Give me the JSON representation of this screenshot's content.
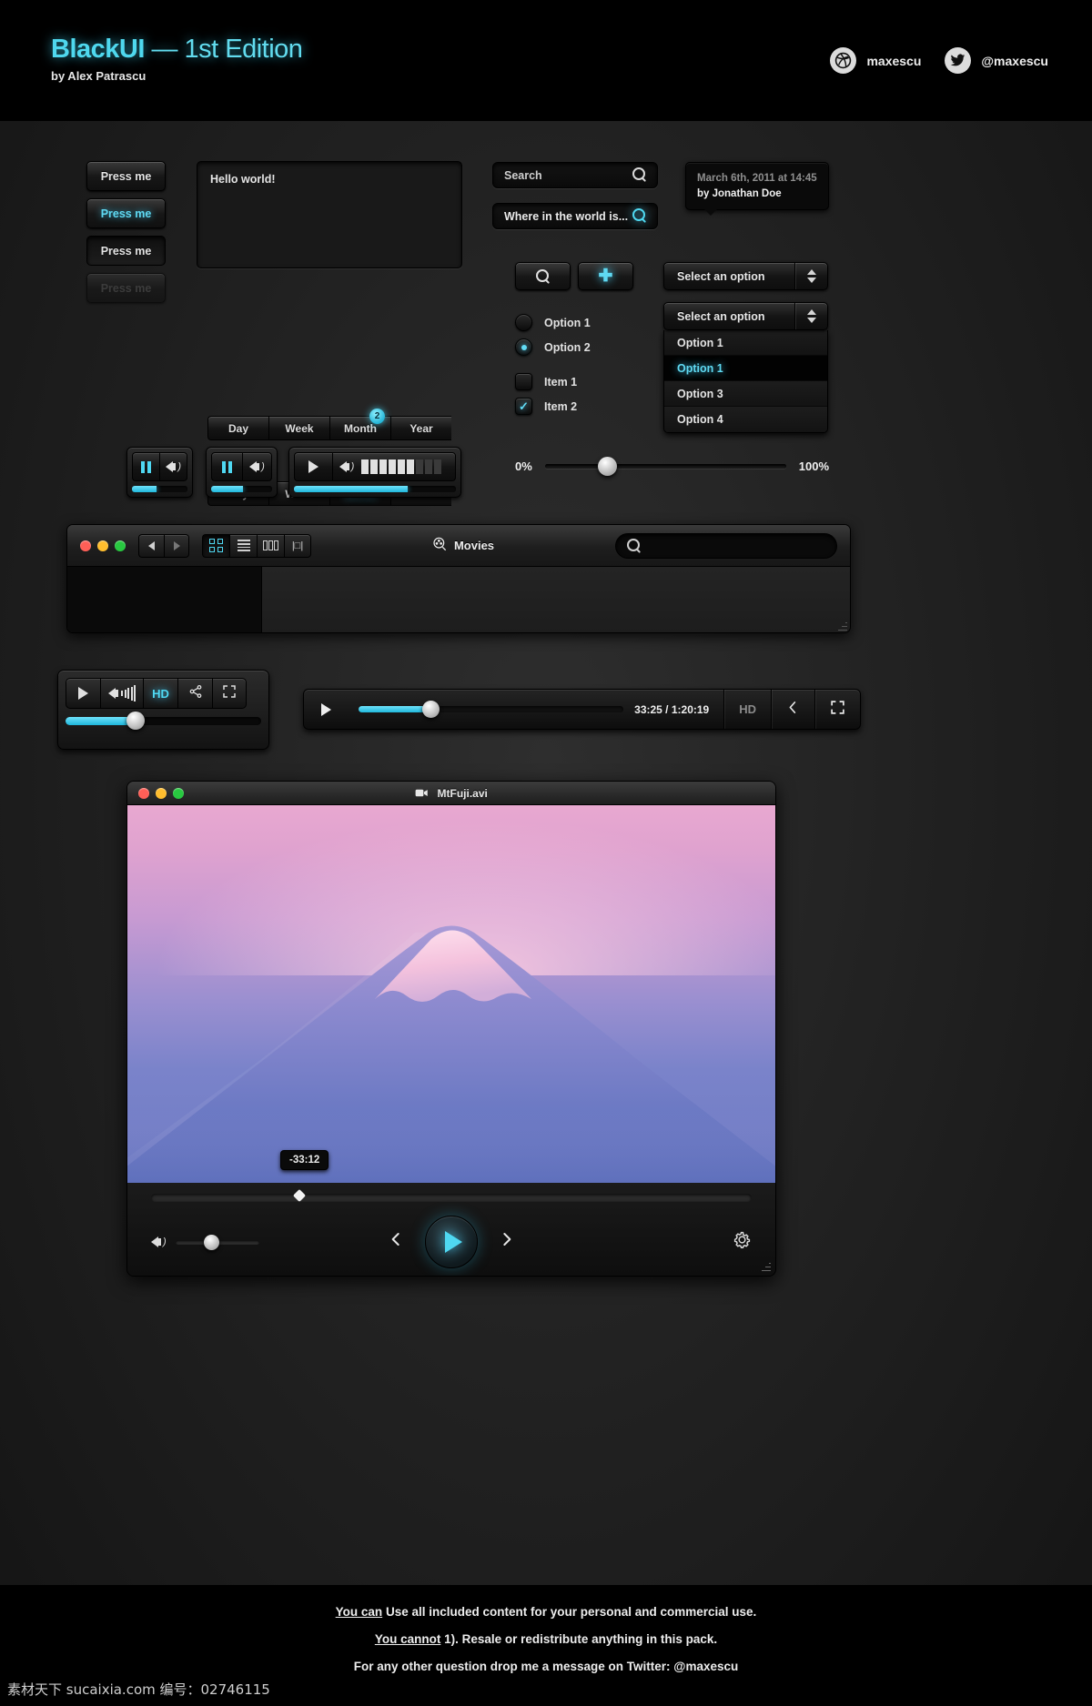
{
  "header": {
    "brand_bold": "BlackUI",
    "brand_rest": "— 1st Edition",
    "subtitle": "by Alex Patrascu",
    "socials": [
      {
        "icon": "dribbble-icon",
        "glyph": "◎",
        "label": "maxescu"
      },
      {
        "icon": "twitter-icon",
        "glyph": "ᴠ",
        "label": "@maxescu"
      }
    ]
  },
  "buttons": {
    "press_normal": "Press me",
    "press_hover": "Press me",
    "press_active": "Press me",
    "press_disabled": "Press me"
  },
  "textarea": {
    "value": "Hello world!"
  },
  "segmented": {
    "items": [
      "Day",
      "Week",
      "Month",
      "Year"
    ],
    "badge": "2",
    "row1_active_index": 2,
    "row2_active_index": 2,
    "row3_active_index": -1
  },
  "search": {
    "field1_placeholder": "Search",
    "field1_value": "Search",
    "field2_value": "Where in the world is...",
    "icon": "search-icon"
  },
  "tooltip": {
    "date": "March 6th, 2011 at 14:45",
    "author": "by Jonathan Doe"
  },
  "icon_buttons": {
    "search_icon": "search-icon",
    "add_icon": "plus-icon",
    "add_glyph": "✚"
  },
  "radios": [
    {
      "label": "Option 1",
      "checked": false
    },
    {
      "label": "Option 2",
      "checked": true
    }
  ],
  "checkboxes": [
    {
      "label": "Item 1",
      "checked": false
    },
    {
      "label": "Item 2",
      "checked": true
    }
  ],
  "dropdown": {
    "placeholder": "Select an option",
    "open_placeholder": "Select an option",
    "options": [
      "Option 1",
      "Option 1",
      "Option 3",
      "Option 4"
    ],
    "highlighted_index": 1
  },
  "mini_players": {
    "player1": {
      "state": "pause",
      "progress_pct": 45
    },
    "player2": {
      "state": "pause",
      "progress_pct": 52
    },
    "player3": {
      "state": "play",
      "progress_pct": 70,
      "volume_cells": 9,
      "volume_on": 6
    }
  },
  "slider": {
    "min_label": "0%",
    "max_label": "100%",
    "value_pct": 22
  },
  "finder": {
    "title": "Movies",
    "title_icon": "film-reel-icon",
    "traffic_lights": [
      "#ff5f57",
      "#ffbd2e",
      "#28c840"
    ],
    "nav_back_icon": "chevron-left-icon",
    "nav_forward_icon": "chevron-right-icon",
    "views": [
      "icon-view",
      "list-view",
      "column-view",
      "coverflow-view"
    ],
    "active_view_index": 0,
    "search_icon": "search-icon"
  },
  "video_small": {
    "play_icon": "play-icon",
    "volume_icon": "volume-icon",
    "hd_label": "HD",
    "share_icon": "share-icon",
    "fullscreen_icon": "fullscreen-icon",
    "progress_pct": 33
  },
  "video_wide": {
    "play_icon": "play-icon",
    "time": "33:25 / 1:20:19",
    "hd_label": "HD",
    "share_icon": "share-icon",
    "fullscreen_icon": "fullscreen-icon",
    "progress_pct": 26
  },
  "fuji": {
    "window_title": "MtFuji.avi",
    "window_icon": "video-camera-icon",
    "traffic_lights": [
      "#ff5f57",
      "#ffbd2e",
      "#28c840"
    ],
    "time_remaining": "-33:12",
    "seek_pct": 24,
    "volume_pct": 34,
    "prev_icon": "chevron-left-icon",
    "play_icon": "play-icon",
    "next_icon": "chevron-right-icon",
    "settings_icon": "gear-icon",
    "volume_icon": "volume-icon"
  },
  "footer": {
    "line1_label": "You can",
    "line1_text": "Use all included content for your personal and commercial use.",
    "line2_label": "You cannot",
    "line2_text": "1). Resale or redistribute anything in this pack.",
    "line3": "For any other question drop me a message on Twitter: @maxescu",
    "watermark": "素材天下 sucaixia.com 编号：02746115"
  },
  "colors": {
    "accent": "#4fd8f2",
    "background": "#1c1c1c",
    "panel": "#141414"
  }
}
